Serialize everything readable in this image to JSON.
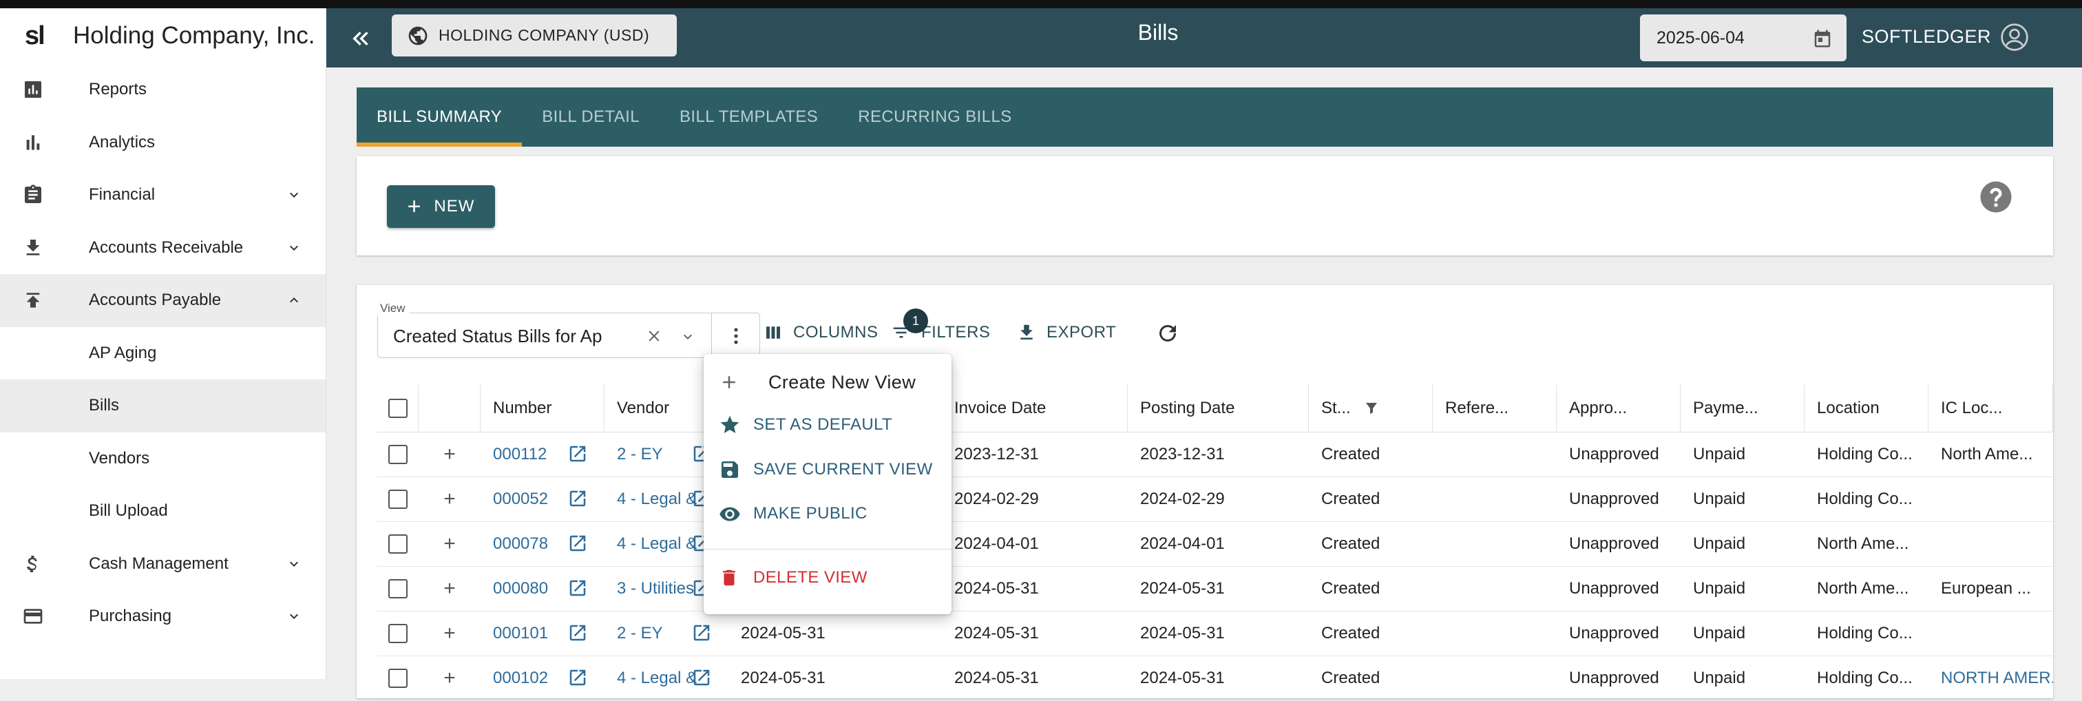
{
  "sidebar": {
    "logo": "sl",
    "company": "Holding Company, Inc.",
    "items": [
      {
        "label": "Reports",
        "icon": "bar-chart-icon"
      },
      {
        "label": "Analytics",
        "icon": "analytics-icon"
      },
      {
        "label": "Financial",
        "icon": "clipboard-icon",
        "expandable": true
      },
      {
        "label": "Accounts Receivable",
        "icon": "download-icon",
        "expandable": true
      },
      {
        "label": "Accounts Payable",
        "icon": "upload-icon",
        "expandable": true,
        "expanded": true
      },
      {
        "label": "AP Aging",
        "sub": true
      },
      {
        "label": "Bills",
        "sub": true,
        "active": true
      },
      {
        "label": "Vendors",
        "sub": true
      },
      {
        "label": "Bill Upload",
        "sub": true
      },
      {
        "label": "Cash Management",
        "icon": "dollar-icon",
        "expandable": true
      },
      {
        "label": "Purchasing",
        "icon": "card-icon",
        "expandable": true
      }
    ]
  },
  "topbar": {
    "company_button": "HOLDING COMPANY (USD)",
    "title": "Bills",
    "date": "2025-06-04",
    "user": "SOFTLEDGER"
  },
  "tabs": [
    "BILL SUMMARY",
    "BILL DETAIL",
    "BILL TEMPLATES",
    "RECURRING BILLS"
  ],
  "actions": {
    "new_label": "NEW"
  },
  "toolbar": {
    "view_label": "View",
    "view_value": "Created Status Bills for Ap",
    "columns": "COLUMNS",
    "filters": "FILTERS",
    "filter_count": "1",
    "export": "EXPORT"
  },
  "view_menu": {
    "create": "Create New View",
    "set_default": "SET AS DEFAULT",
    "save": "SAVE CURRENT VIEW",
    "make_public": "MAKE PUBLIC",
    "delete": "DELETE VIEW"
  },
  "table": {
    "columns": [
      "Number",
      "Vendor",
      "",
      "Invoice Date",
      "Posting Date",
      "St...",
      "Refere...",
      "Appro...",
      "Payme...",
      "Location",
      "IC Loc..."
    ],
    "rows": [
      [
        "000112",
        "2 - EY",
        "",
        "2023-12-31",
        "2023-12-31",
        "Created",
        "",
        "Unapproved",
        "Unpaid",
        "Holding Co...",
        "North Ame..."
      ],
      [
        "000052",
        "4 - Legal &",
        "",
        "2024-02-29",
        "2024-02-29",
        "Created",
        "",
        "Unapproved",
        "Unpaid",
        "Holding Co...",
        ""
      ],
      [
        "000078",
        "4 - Legal &",
        "",
        "2024-04-01",
        "2024-04-01",
        "Created",
        "",
        "Unapproved",
        "Unpaid",
        "North Ame...",
        ""
      ],
      [
        "000080",
        "3 - Utilities",
        "",
        "2024-05-31",
        "2024-05-31",
        "Created",
        "",
        "Unapproved",
        "Unpaid",
        "North Ame...",
        "European ..."
      ],
      [
        "000101",
        "2 - EY",
        "2024-05-31",
        "2024-05-31",
        "2024-05-31",
        "Created",
        "",
        "Unapproved",
        "Unpaid",
        "Holding Co...",
        ""
      ],
      [
        "000102",
        "4 - Legal &",
        "2024-05-31",
        "2024-05-31",
        "2024-05-31",
        "Created",
        "",
        "Unapproved",
        "Unpaid",
        "Holding Co...",
        "NORTH AMER..."
      ]
    ]
  },
  "colors": {
    "topbar": "#2d4e59",
    "tabs": "#2d5e66",
    "accent": "#f0a22e",
    "link": "#2f6c9a",
    "danger": "#d32f2f"
  }
}
